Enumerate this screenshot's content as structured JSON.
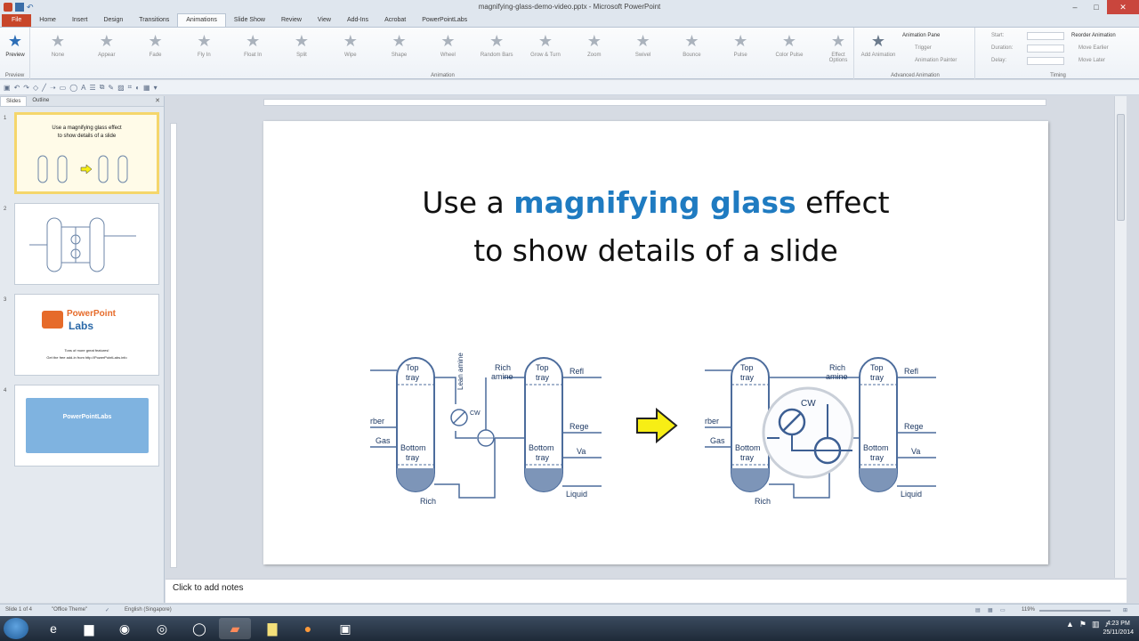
{
  "window": {
    "title": "magnifying-glass-demo-video.pptx - Microsoft PowerPoint"
  },
  "tabs": [
    "File",
    "Home",
    "Insert",
    "Design",
    "Transitions",
    "Animations",
    "Slide Show",
    "Review",
    "View",
    "Add-Ins",
    "Acrobat",
    "PowerPointLabs"
  ],
  "ribbon": {
    "preview_label": "Preview",
    "preview_group": "Preview",
    "effects": [
      "None",
      "Appear",
      "Fade",
      "Fly In",
      "Float In",
      "Split",
      "Wipe",
      "Shape",
      "Wheel",
      "Random Bars",
      "Grow & Turn",
      "Zoom",
      "Swivel",
      "Bounce",
      "Pulse",
      "Color Pulse"
    ],
    "effect_options": "Effect Options",
    "animation_group": "Animation",
    "add_animation": "Add Animation",
    "animation_pane": "Animation Pane",
    "trigger": "Trigger",
    "animation_painter": "Animation Painter",
    "advanced_group": "Advanced Animation",
    "start": "Start:",
    "duration": "Duration:",
    "delay": "Delay:",
    "reorder": "Reorder Animation",
    "move_earlier": "Move Earlier",
    "move_later": "Move Later",
    "timing_group": "Timing"
  },
  "pane": {
    "tab_slides": "Slides",
    "tab_outline": "Outline",
    "thumbs": [
      {
        "num": "1",
        "line1": "Use a magnifying glass effect",
        "line2": "to show details of a slide"
      },
      {
        "num": "2"
      },
      {
        "num": "3",
        "logo": "PowerPoint",
        "logo2": "Labs",
        "line1": "Tons of more great features!",
        "line2": "Get the free add-in from http://PowerPointLabs.info"
      },
      {
        "num": "4",
        "banner": "PowerPointLabs"
      }
    ]
  },
  "slide": {
    "title_pre": "Use a",
    "title_highlight": "magnifying glass",
    "title_post": "effect",
    "title_line2": "to show details of a slide",
    "diagram_labels": {
      "top_tray": "Top",
      "top_tray2": "tray",
      "bottom_tray": "Bottom",
      "bottom_tray2": "tray",
      "lean_amine": "Lean amine",
      "rich_amine": "Rich",
      "rich_amine2": "amine",
      "cw": "CW",
      "gas": "Gas",
      "absorber": "rber",
      "rich": "Rich",
      "reflux": "Refl",
      "regen": "Rege",
      "vapor": "Va",
      "liquid": "Liquid"
    }
  },
  "notes": {
    "placeholder": "Click to add notes"
  },
  "status": {
    "slide_of": "Slide 1 of 4",
    "theme": "\"Office Theme\"",
    "language": "English (Singapore)",
    "zoom": "119%"
  },
  "clock": {
    "time": "4:23 PM",
    "date": "25/11/2014"
  },
  "colors": {
    "accent": "#1f7bc1",
    "file_tab": "#c8462a",
    "selected_thumb": "#f5d66b",
    "arrow_fill": "#f7ee15"
  }
}
